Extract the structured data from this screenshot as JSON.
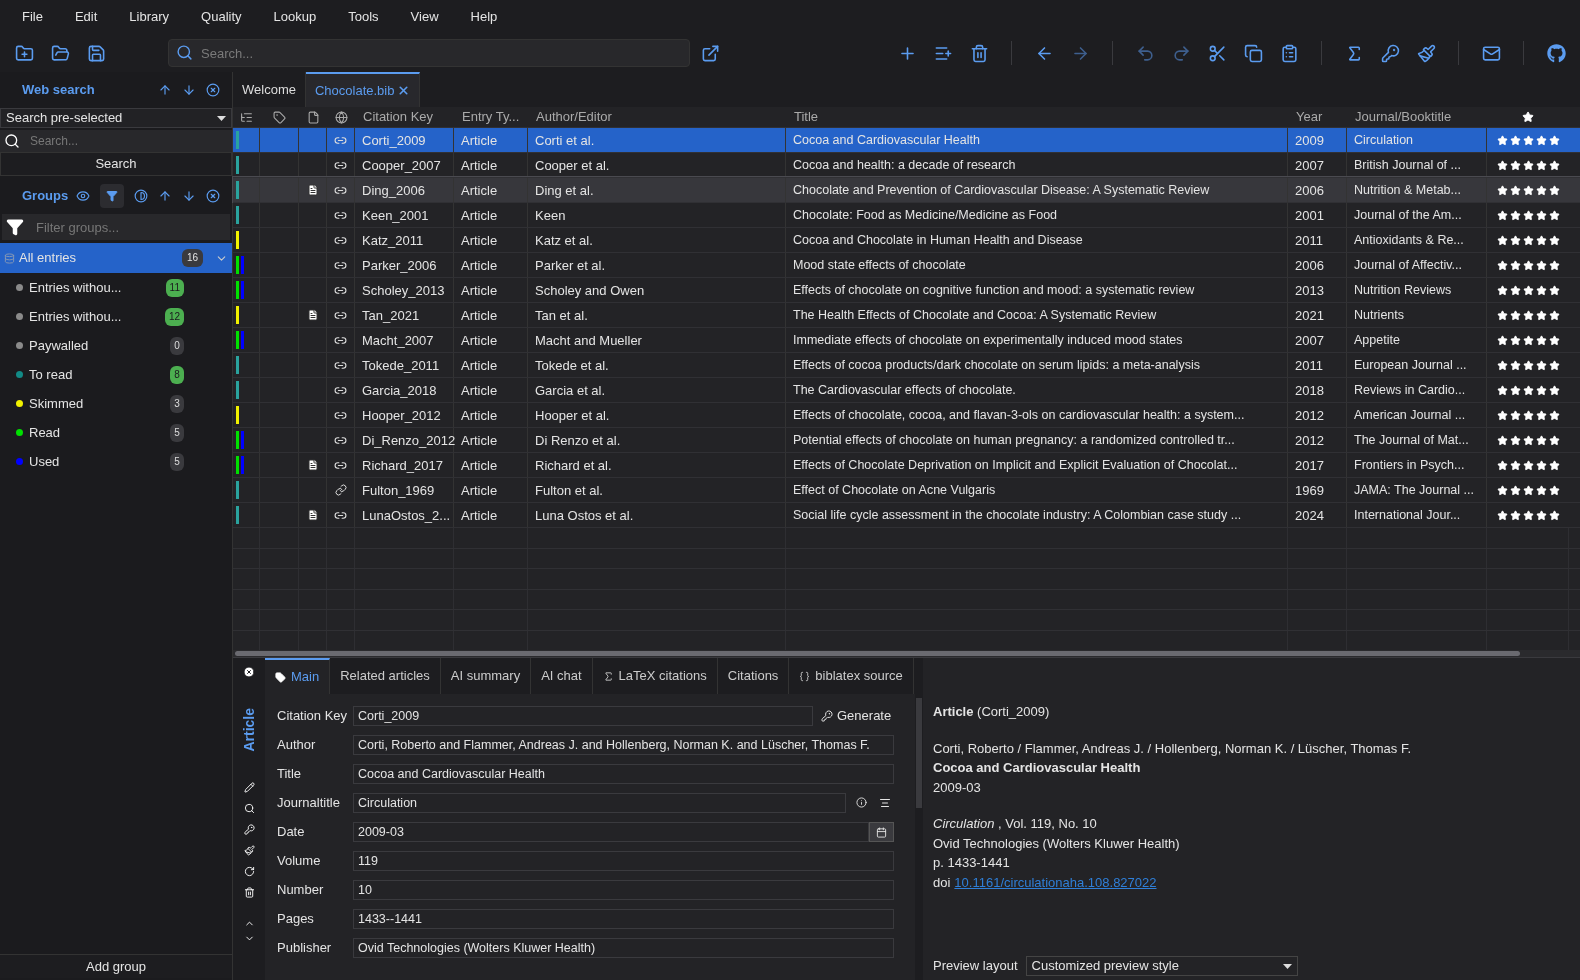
{
  "menu": [
    "File",
    "Edit",
    "Library",
    "Quality",
    "Lookup",
    "Tools",
    "View",
    "Help"
  ],
  "toolbar": {
    "search_placeholder": "Search..."
  },
  "web_search": {
    "title": "Web search",
    "fetcher": "Search pre-selected",
    "placeholder": "Search...",
    "button": "Search"
  },
  "groups": {
    "title": "Groups",
    "filter_placeholder": "Filter groups...",
    "all": {
      "name": "All entries",
      "count": "16",
      "selected": true
    },
    "items": [
      {
        "name": "Entries withou...",
        "count": "11",
        "color": "#8a8a8a",
        "matched": true
      },
      {
        "name": "Entries withou...",
        "count": "12",
        "color": "#8a8a8a",
        "matched": true
      },
      {
        "name": "Paywalled",
        "count": "0",
        "color": "#8a8a8a",
        "matched": false
      },
      {
        "name": "To read",
        "count": "8",
        "color": "#128a86",
        "matched": true
      },
      {
        "name": "Skimmed",
        "count": "3",
        "color": "#f2f200",
        "matched": false
      },
      {
        "name": "Read",
        "count": "5",
        "color": "#00e000",
        "matched": false
      },
      {
        "name": "Used",
        "count": "5",
        "color": "#0000ff",
        "matched": false
      }
    ],
    "add_button": "Add group"
  },
  "tabs": [
    {
      "label": "Welcome",
      "selected": false,
      "closable": false
    },
    {
      "label": "Chocolate.bib",
      "selected": true,
      "closable": true
    }
  ],
  "table": {
    "columns": [
      "Citation Key",
      "Entry Ty...",
      "Author/Editor",
      "Title",
      "Year",
      "Journal/Booktitle"
    ],
    "rows": [
      {
        "key": "Corti_2009",
        "type": "Article",
        "author": "Corti et al.",
        "title": "Cocoa and Cardiovascular Health",
        "year": "2009",
        "journal": "Circulation",
        "groups": [
          {
            "color": "#2aa39e"
          }
        ],
        "pdf": false,
        "kind": "chain",
        "stars": 5,
        "selected": true,
        "highlighted": false
      },
      {
        "key": "Cooper_2007",
        "type": "Article",
        "author": "Cooper et al.",
        "title": "Cocoa and health: a decade of research",
        "year": "2007",
        "journal": "British Journal of ...",
        "groups": [
          {
            "color": "#2aa39e"
          }
        ],
        "pdf": false,
        "kind": "chain",
        "stars": 5,
        "selected": false,
        "highlighted": false
      },
      {
        "key": "Ding_2006",
        "type": "Article",
        "author": "Ding et al.",
        "title": "Chocolate and Prevention of Cardiovascular Disease: A Systematic Review",
        "year": "2006",
        "journal": "Nutrition & Metab...",
        "groups": [
          {
            "color": "#2aa39e"
          }
        ],
        "pdf": true,
        "kind": "chain",
        "stars": 5,
        "selected": false,
        "highlighted": true
      },
      {
        "key": "Keen_2001",
        "type": "Article",
        "author": "Keen",
        "title": "Chocolate: Food as Medicine/Medicine as Food",
        "year": "2001",
        "journal": "Journal of the Am...",
        "groups": [
          {
            "color": "#2aa39e"
          }
        ],
        "pdf": false,
        "kind": "chain",
        "stars": 5,
        "selected": false,
        "highlighted": false
      },
      {
        "key": "Katz_2011",
        "type": "Article",
        "author": "Katz et al.",
        "title": "Cocoa and Chocolate in Human Health and Disease",
        "year": "2011",
        "journal": "Antioxidants & Re...",
        "groups": [
          {
            "color": "#f2f200"
          }
        ],
        "pdf": false,
        "kind": "chain",
        "stars": 5,
        "selected": false,
        "highlighted": false
      },
      {
        "key": "Parker_2006",
        "type": "Article",
        "author": "Parker et al.",
        "title": "Mood state effects of chocolate",
        "year": "2006",
        "journal": "Journal of Affectiv...",
        "groups": [
          {
            "color": "#00e000"
          },
          {
            "color": "#0000ff"
          }
        ],
        "pdf": false,
        "kind": "chain",
        "stars": 5,
        "selected": false,
        "highlighted": false
      },
      {
        "key": "Scholey_2013",
        "type": "Article",
        "author": "Scholey and Owen",
        "title": "Effects of chocolate on cognitive function and mood: a systematic review",
        "year": "2013",
        "journal": "Nutrition Reviews",
        "groups": [
          {
            "color": "#00e000"
          },
          {
            "color": "#0000ff"
          }
        ],
        "pdf": false,
        "kind": "chain",
        "stars": 5,
        "selected": false,
        "highlighted": false
      },
      {
        "key": "Tan_2021",
        "type": "Article",
        "author": "Tan et al.",
        "title": "The Health Effects of Chocolate and Cocoa: A Systematic Review",
        "year": "2021",
        "journal": "Nutrients",
        "groups": [
          {
            "color": "#f2f200"
          }
        ],
        "pdf": true,
        "kind": "chain",
        "stars": 5,
        "selected": false,
        "highlighted": false
      },
      {
        "key": "Macht_2007",
        "type": "Article",
        "author": "Macht and Mueller",
        "title": "Immediate effects of chocolate on experimentally induced mood states",
        "year": "2007",
        "journal": "Appetite",
        "groups": [
          {
            "color": "#00e000"
          },
          {
            "color": "#0000ff"
          }
        ],
        "pdf": false,
        "kind": "chain",
        "stars": 5,
        "selected": false,
        "highlighted": false
      },
      {
        "key": "Tokede_2011",
        "type": "Article",
        "author": "Tokede et al.",
        "title": "Effects of cocoa products/dark chocolate on serum lipids: a meta-analysis",
        "year": "2011",
        "journal": "European Journal ...",
        "groups": [
          {
            "color": "#2aa39e"
          }
        ],
        "pdf": false,
        "kind": "chain",
        "stars": 5,
        "selected": false,
        "highlighted": false
      },
      {
        "key": "Garcia_2018",
        "type": "Article",
        "author": "Garcia et al.",
        "title": "The Cardiovascular effects of chocolate.",
        "year": "2018",
        "journal": "Reviews in Cardio...",
        "groups": [
          {
            "color": "#2aa39e"
          }
        ],
        "pdf": false,
        "kind": "chain",
        "stars": 5,
        "selected": false,
        "highlighted": false
      },
      {
        "key": "Hooper_2012",
        "type": "Article",
        "author": "Hooper et al.",
        "title": "Effects of chocolate, cocoa, and flavan-3-ols on cardiovascular health: a system...",
        "year": "2012",
        "journal": "American Journal ...",
        "groups": [
          {
            "color": "#f2f200"
          }
        ],
        "pdf": false,
        "kind": "chain",
        "stars": 5,
        "selected": false,
        "highlighted": false
      },
      {
        "key": "Di_Renzo_2012",
        "type": "Article",
        "author": "Di Renzo et al.",
        "title": "Potential effects of chocolate on human pregnancy: a randomized controlled tr...",
        "year": "2012",
        "journal": "The Journal of Mat...",
        "groups": [
          {
            "color": "#00e000"
          },
          {
            "color": "#0000ff"
          }
        ],
        "pdf": false,
        "kind": "chain",
        "stars": 5,
        "selected": false,
        "highlighted": false
      },
      {
        "key": "Richard_2017",
        "type": "Article",
        "author": "Richard et al.",
        "title": "Effects of Chocolate Deprivation on Implicit and Explicit Evaluation of Chocolat...",
        "year": "2017",
        "journal": "Frontiers in Psych...",
        "groups": [
          {
            "color": "#00e000"
          },
          {
            "color": "#0000ff"
          }
        ],
        "pdf": true,
        "kind": "chain",
        "stars": 5,
        "selected": false,
        "highlighted": false
      },
      {
        "key": "Fulton_1969",
        "type": "Article",
        "author": "Fulton et al.",
        "title": "Effect of Chocolate on Acne Vulgaris",
        "year": "1969",
        "journal": "JAMA: The Journal ...",
        "groups": [
          {
            "color": "#2aa39e"
          }
        ],
        "pdf": false,
        "kind": "diagonal",
        "stars": 5,
        "selected": false,
        "highlighted": false
      },
      {
        "key": "LunaOstos_2...",
        "type": "Article",
        "author": "Luna Ostos et al.",
        "title": "Social life cycle assessment in the chocolate industry: A Colombian case study ...",
        "year": "2024",
        "journal": "International Jour...",
        "groups": [
          {
            "color": "#2aa39e"
          }
        ],
        "pdf": true,
        "kind": "chain",
        "stars": 5,
        "selected": false,
        "highlighted": false
      }
    ]
  },
  "editor": {
    "entry_type": "Article",
    "tabs": [
      {
        "label": "Main",
        "kind": "main",
        "selected": true
      },
      {
        "label": "Related articles",
        "kind": "plain",
        "selected": false
      },
      {
        "label": "AI summary",
        "kind": "plain",
        "selected": false
      },
      {
        "label": "AI chat",
        "kind": "plain",
        "selected": false
      },
      {
        "label": "LaTeX citations",
        "kind": "latex",
        "selected": false
      },
      {
        "label": "Citations",
        "kind": "plain",
        "selected": false
      },
      {
        "label": "biblatex source",
        "kind": "source",
        "selected": false
      }
    ],
    "generate_button": "Generate",
    "fields": [
      {
        "label": "Citation Key",
        "value": "Corti_2009",
        "kind": "key"
      },
      {
        "label": "Author",
        "value": "Corti, Roberto and Flammer, Andreas J. and Hollenberg, Norman K. and Lüscher, Thomas F.",
        "kind": "plain"
      },
      {
        "label": "Title",
        "value": "Cocoa and Cardiovascular Health",
        "kind": "plain"
      },
      {
        "label": "Journaltitle",
        "value": "Circulation",
        "kind": "journal"
      },
      {
        "label": "Date",
        "value": "2009-03",
        "kind": "date"
      },
      {
        "label": "Volume",
        "value": "119",
        "kind": "plain"
      },
      {
        "label": "Number",
        "value": "10",
        "kind": "plain"
      },
      {
        "label": "Pages",
        "value": "1433--1441",
        "kind": "plain"
      },
      {
        "label": "Publisher",
        "value": "Ovid Technologies (Wolters Kluwer Health)",
        "kind": "plain"
      }
    ]
  },
  "preview": {
    "heading": "**Article** (Corti_2009)",
    "authors": "Corti, Roberto / Flammer, Andreas J. / Hollenberg, Norman K. / Lüscher, Thomas F.",
    "title": "Cocoa and Cardiovascular Health",
    "date": "2009-03",
    "journal_line": "*Circulation* , Vol. 119, No. 10",
    "publisher": "Ovid Technologies (Wolters Kluwer Health)",
    "pages": "p. 1433-1441",
    "doi_label": "doi",
    "doi": "10.1161/circulationaha.108.827022",
    "layout_label": "Preview layout",
    "layout_value": "Customized preview style"
  }
}
